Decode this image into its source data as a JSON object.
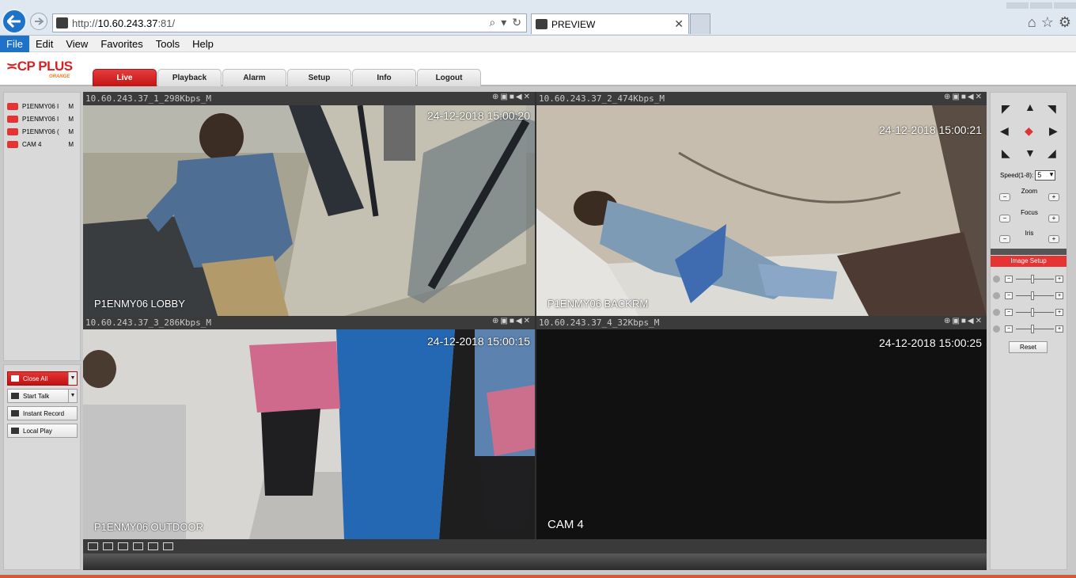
{
  "browser": {
    "url_prefix": "http://",
    "url_host": "10.60.243.37",
    "url_suffix": ":81/",
    "tab_title": "PREVIEW",
    "menu": [
      "File",
      "Edit",
      "View",
      "Favorites",
      "Tools",
      "Help"
    ]
  },
  "app": {
    "logo": "CP PLUS",
    "logo_sub": "ORANGE",
    "tabs": [
      "Live",
      "Playback",
      "Alarm",
      "Setup",
      "Info",
      "Logout"
    ],
    "active_tab": "Live"
  },
  "cameras": [
    {
      "name": "P1ENMY06 I",
      "mode": "M"
    },
    {
      "name": "P1ENMY06 I",
      "mode": "M"
    },
    {
      "name": "P1ENMY06 (",
      "mode": "M"
    },
    {
      "name": "CAM 4",
      "mode": "M"
    }
  ],
  "controls": {
    "close_all": "Close All",
    "start_talk": "Start Talk",
    "instant_record": "Instant Record",
    "local_play": "Local Play"
  },
  "panes": [
    {
      "caption": "10.60.243.37_1_298Kbps_M",
      "timestamp": "24-12-2018 15:00:20",
      "name": "P1ENMY06 LOBBY"
    },
    {
      "caption": "10.60.243.37_2_474Kbps_M",
      "timestamp": "24-12-2018 15:00:21",
      "name": "P1ENMY06 BACKRM"
    },
    {
      "caption": "10.60.243.37_3_286Kbps_M",
      "timestamp": "24-12-2018 15:00:15",
      "name": "P1ENMY06 OUTDOOR"
    },
    {
      "caption": "10.60.243.37_4_32Kbps_M",
      "timestamp": "24-12-2018 15:00:25",
      "name": "CAM 4"
    }
  ],
  "ptz": {
    "speed_label": "Speed(1-8):",
    "speed_value": "5",
    "zoom": "Zoom",
    "focus": "Focus",
    "iris": "Iris",
    "image_setup": "Image Setup",
    "reset": "Reset"
  }
}
